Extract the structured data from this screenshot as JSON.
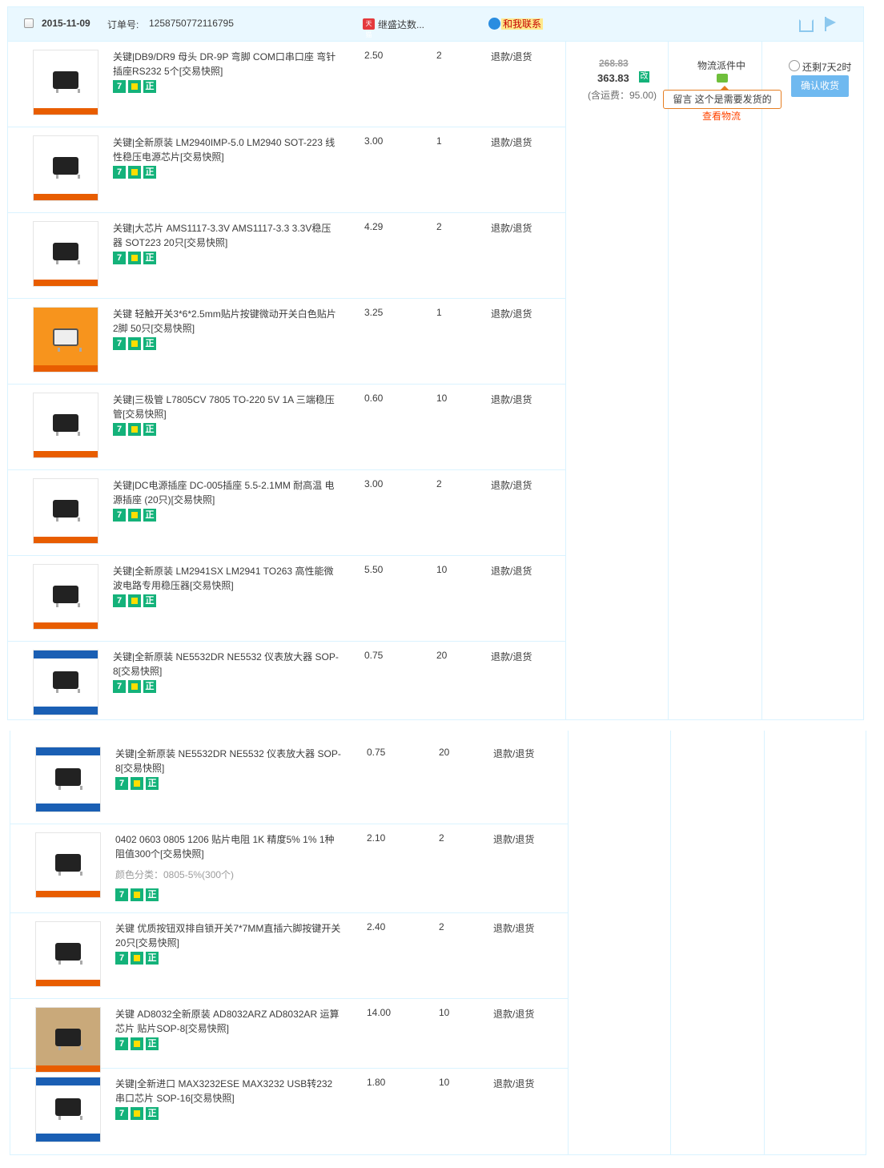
{
  "header": {
    "date": "2015-11-09",
    "order_label": "订单号:",
    "order_no": "1258750772116795",
    "shop_icon_text": "天猫",
    "shop_name": "继盛达数...",
    "contact": "和我联系"
  },
  "summary": {
    "original_price": "268.83",
    "total": "363.83",
    "modify_badge": "改",
    "shipping": "(含运费：95.00)",
    "logistics_status": "物流派件中",
    "message_tip": "留言 这个是需要发货的",
    "view_logistics": "查看物流",
    "countdown": "还剩7天2时",
    "confirm_button": "确认收货"
  },
  "badges": {
    "seven": "7",
    "real": "正"
  },
  "items_panel1": [
    {
      "title": "关键|DB9/DR9 母头 DR-9P 弯脚 COM口串口座 弯针插座RS232 5个[交易快照]",
      "price": "2.50",
      "qty": "2",
      "refund": "退款/退货",
      "thumb": "standard"
    },
    {
      "title": "关键|全新原装 LM2940IMP-5.0 LM2940 SOT-223 线性稳压电源芯片[交易快照]",
      "price": "3.00",
      "qty": "1",
      "refund": "退款/退货",
      "thumb": "standard"
    },
    {
      "title": "关键|大芯片 AMS1117-3.3V AMS1117-3.3 3.3V稳压器 SOT223 20只[交易快照]",
      "price": "4.29",
      "qty": "2",
      "refund": "退款/退货",
      "thumb": "standard"
    },
    {
      "title": "关键 轻触开关3*6*2.5mm贴片按键微动开关白色贴片2脚 50只[交易快照]",
      "price": "3.25",
      "qty": "1",
      "refund": "退款/退货",
      "thumb": "orange"
    },
    {
      "title": "关键|三极管 L7805CV 7805 TO-220 5V 1A 三端稳压管[交易快照]",
      "price": "0.60",
      "qty": "10",
      "refund": "退款/退货",
      "thumb": "standard"
    },
    {
      "title": "关键|DC电源插座 DC-005插座 5.5-2.1MM 耐高温 电源插座 (20只)[交易快照]",
      "price": "3.00",
      "qty": "2",
      "refund": "退款/退货",
      "thumb": "standard"
    },
    {
      "title": "关键|全新原装 LM2941SX LM2941 TO263 高性能微波电路专用稳压器[交易快照]",
      "price": "5.50",
      "qty": "10",
      "refund": "退款/退货",
      "thumb": "plain"
    },
    {
      "title": "关键|全新原装 NE5532DR NE5532 仪表放大器 SOP-8[交易快照]",
      "price": "0.75",
      "qty": "20",
      "refund": "退款/退货",
      "thumb": "blue"
    }
  ],
  "items_panel2": [
    {
      "title": "关键|全新原装 NE5532DR NE5532 仪表放大器 SOP-8[交易快照]",
      "price": "0.75",
      "qty": "20",
      "refund": "退款/退货",
      "thumb": "blue",
      "sku": ""
    },
    {
      "title": "0402 0603 0805 1206 贴片电阻 1K 精度5% 1% 1种阻值300个[交易快照]",
      "price": "2.10",
      "qty": "2",
      "refund": "退款/退货",
      "thumb": "standard",
      "sku": "颜色分类：0805-5%(300个)"
    },
    {
      "title": "关键 优质按钮双排自锁开关7*7MM直插六脚按键开关 20只[交易快照]",
      "price": "2.40",
      "qty": "2",
      "refund": "退款/退货",
      "thumb": "standard",
      "sku": ""
    },
    {
      "title": "关键 AD8032全新原装 AD8032ARZ AD8032AR 运算芯片 贴片SOP-8[交易快照]",
      "price": "14.00",
      "qty": "10",
      "refund": "退款/退货",
      "thumb": "photo",
      "sku": ""
    },
    {
      "title": "关键|全新进口 MAX3232ESE MAX3232 USB转232 串口芯片 SOP-16[交易快照]",
      "price": "1.80",
      "qty": "10",
      "refund": "退款/退货",
      "thumb": "blue",
      "sku": ""
    }
  ]
}
